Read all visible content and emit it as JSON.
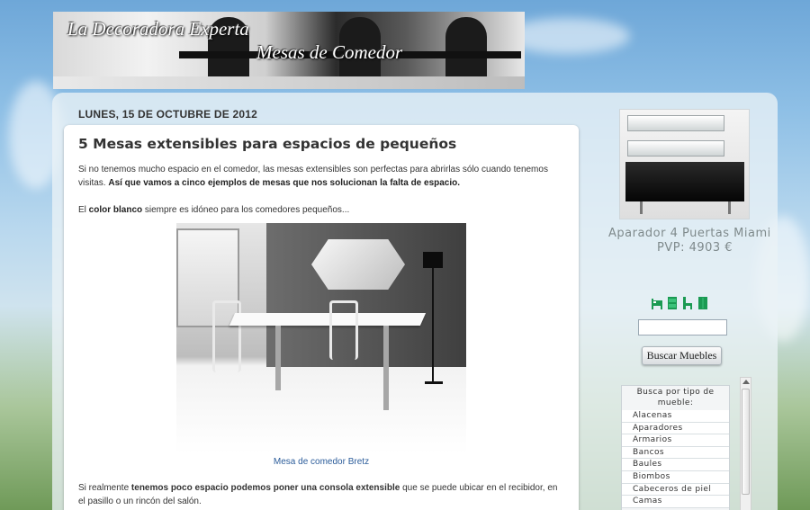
{
  "header": {
    "title": "La Decoradora Experta",
    "subtitle": "Mesas de Comedor"
  },
  "post": {
    "date": "LUNES, 15 DE OCTUBRE DE 2012",
    "title": "5 Mesas extensibles para espacios de pequeños",
    "para1_text": "Si no tenemos mucho espacio en el comedor, las mesas extensibles son perfectas para abrirlas sólo cuando tenemos visitas. ",
    "para1_bold": "Así que vamos a cinco ejemplos de mesas que nos solucionan la falta de espacio.",
    "para2_lead": "El ",
    "para2_bold": "color blanco",
    "para2_rest": " siempre es idóneo para los comedores pequeños...",
    "caption": "Mesa de comedor Bretz",
    "para3_text": "Si realmente ",
    "para3_bold": "tenemos poco espacio podemos poner una consola extensible",
    "para3_rest": " que se puede ubicar en el recibidor, en el pasillo o un rincón del salón."
  },
  "sidebar": {
    "ad_title": "Aparador 4 Puertas Miami",
    "ad_price": "PVP: 4903 €",
    "search_placeholder": "",
    "search_button": "Buscar Muebles",
    "type_list_header": "Busca por tipo de mueble:",
    "type_items": [
      "Alacenas",
      "Aparadores",
      "Armarios",
      "Bancos",
      "Baules",
      "Biombos",
      "Cabeceros de piel",
      "Camas"
    ],
    "icon_names": [
      "bed-icon",
      "cabinet-icon",
      "chair-icon",
      "wardrobe-icon"
    ],
    "icon_color": "#1a9a52"
  },
  "colors": {
    "link": "#2b5c9a",
    "text": "#333333"
  }
}
